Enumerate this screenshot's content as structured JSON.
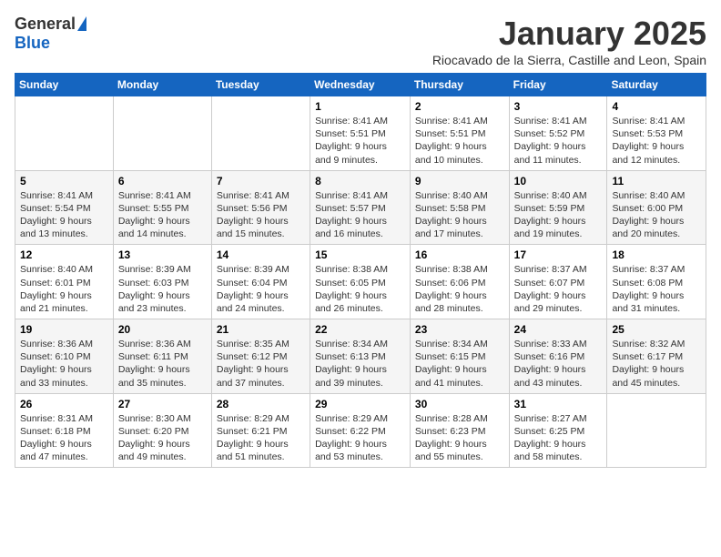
{
  "logo": {
    "general": "General",
    "blue": "Blue"
  },
  "title": "January 2025",
  "subtitle": "Riocavado de la Sierra, Castille and Leon, Spain",
  "days_header": [
    "Sunday",
    "Monday",
    "Tuesday",
    "Wednesday",
    "Thursday",
    "Friday",
    "Saturday"
  ],
  "weeks": [
    [
      {
        "num": "",
        "info": ""
      },
      {
        "num": "",
        "info": ""
      },
      {
        "num": "",
        "info": ""
      },
      {
        "num": "1",
        "info": "Sunrise: 8:41 AM\nSunset: 5:51 PM\nDaylight: 9 hours and 9 minutes."
      },
      {
        "num": "2",
        "info": "Sunrise: 8:41 AM\nSunset: 5:51 PM\nDaylight: 9 hours and 10 minutes."
      },
      {
        "num": "3",
        "info": "Sunrise: 8:41 AM\nSunset: 5:52 PM\nDaylight: 9 hours and 11 minutes."
      },
      {
        "num": "4",
        "info": "Sunrise: 8:41 AM\nSunset: 5:53 PM\nDaylight: 9 hours and 12 minutes."
      }
    ],
    [
      {
        "num": "5",
        "info": "Sunrise: 8:41 AM\nSunset: 5:54 PM\nDaylight: 9 hours and 13 minutes."
      },
      {
        "num": "6",
        "info": "Sunrise: 8:41 AM\nSunset: 5:55 PM\nDaylight: 9 hours and 14 minutes."
      },
      {
        "num": "7",
        "info": "Sunrise: 8:41 AM\nSunset: 5:56 PM\nDaylight: 9 hours and 15 minutes."
      },
      {
        "num": "8",
        "info": "Sunrise: 8:41 AM\nSunset: 5:57 PM\nDaylight: 9 hours and 16 minutes."
      },
      {
        "num": "9",
        "info": "Sunrise: 8:40 AM\nSunset: 5:58 PM\nDaylight: 9 hours and 17 minutes."
      },
      {
        "num": "10",
        "info": "Sunrise: 8:40 AM\nSunset: 5:59 PM\nDaylight: 9 hours and 19 minutes."
      },
      {
        "num": "11",
        "info": "Sunrise: 8:40 AM\nSunset: 6:00 PM\nDaylight: 9 hours and 20 minutes."
      }
    ],
    [
      {
        "num": "12",
        "info": "Sunrise: 8:40 AM\nSunset: 6:01 PM\nDaylight: 9 hours and 21 minutes."
      },
      {
        "num": "13",
        "info": "Sunrise: 8:39 AM\nSunset: 6:03 PM\nDaylight: 9 hours and 23 minutes."
      },
      {
        "num": "14",
        "info": "Sunrise: 8:39 AM\nSunset: 6:04 PM\nDaylight: 9 hours and 24 minutes."
      },
      {
        "num": "15",
        "info": "Sunrise: 8:38 AM\nSunset: 6:05 PM\nDaylight: 9 hours and 26 minutes."
      },
      {
        "num": "16",
        "info": "Sunrise: 8:38 AM\nSunset: 6:06 PM\nDaylight: 9 hours and 28 minutes."
      },
      {
        "num": "17",
        "info": "Sunrise: 8:37 AM\nSunset: 6:07 PM\nDaylight: 9 hours and 29 minutes."
      },
      {
        "num": "18",
        "info": "Sunrise: 8:37 AM\nSunset: 6:08 PM\nDaylight: 9 hours and 31 minutes."
      }
    ],
    [
      {
        "num": "19",
        "info": "Sunrise: 8:36 AM\nSunset: 6:10 PM\nDaylight: 9 hours and 33 minutes."
      },
      {
        "num": "20",
        "info": "Sunrise: 8:36 AM\nSunset: 6:11 PM\nDaylight: 9 hours and 35 minutes."
      },
      {
        "num": "21",
        "info": "Sunrise: 8:35 AM\nSunset: 6:12 PM\nDaylight: 9 hours and 37 minutes."
      },
      {
        "num": "22",
        "info": "Sunrise: 8:34 AM\nSunset: 6:13 PM\nDaylight: 9 hours and 39 minutes."
      },
      {
        "num": "23",
        "info": "Sunrise: 8:34 AM\nSunset: 6:15 PM\nDaylight: 9 hours and 41 minutes."
      },
      {
        "num": "24",
        "info": "Sunrise: 8:33 AM\nSunset: 6:16 PM\nDaylight: 9 hours and 43 minutes."
      },
      {
        "num": "25",
        "info": "Sunrise: 8:32 AM\nSunset: 6:17 PM\nDaylight: 9 hours and 45 minutes."
      }
    ],
    [
      {
        "num": "26",
        "info": "Sunrise: 8:31 AM\nSunset: 6:18 PM\nDaylight: 9 hours and 47 minutes."
      },
      {
        "num": "27",
        "info": "Sunrise: 8:30 AM\nSunset: 6:20 PM\nDaylight: 9 hours and 49 minutes."
      },
      {
        "num": "28",
        "info": "Sunrise: 8:29 AM\nSunset: 6:21 PM\nDaylight: 9 hours and 51 minutes."
      },
      {
        "num": "29",
        "info": "Sunrise: 8:29 AM\nSunset: 6:22 PM\nDaylight: 9 hours and 53 minutes."
      },
      {
        "num": "30",
        "info": "Sunrise: 8:28 AM\nSunset: 6:23 PM\nDaylight: 9 hours and 55 minutes."
      },
      {
        "num": "31",
        "info": "Sunrise: 8:27 AM\nSunset: 6:25 PM\nDaylight: 9 hours and 58 minutes."
      },
      {
        "num": "",
        "info": ""
      }
    ]
  ]
}
